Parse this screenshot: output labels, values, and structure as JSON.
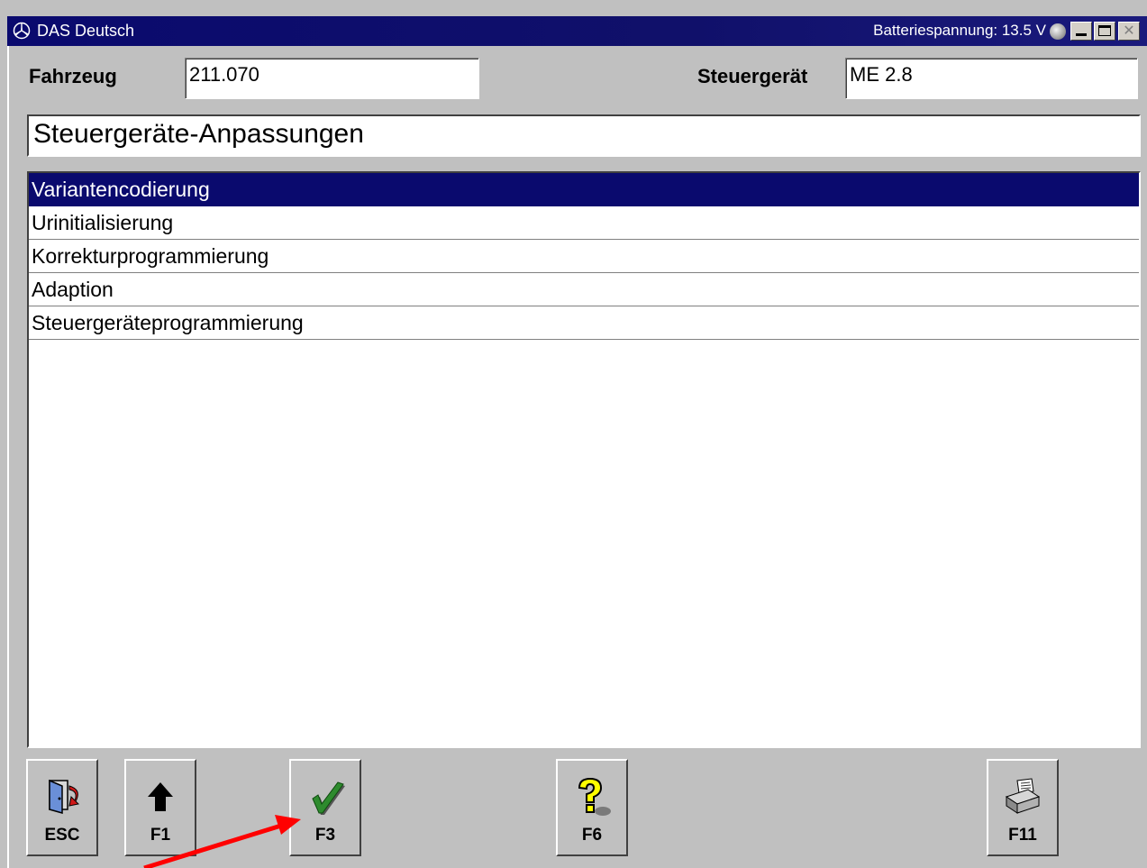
{
  "window": {
    "title": "DAS Deutsch",
    "battery_text": "Batteriespannung: 13.5 V",
    "controls": [
      "minimize-icon",
      "maximize-icon",
      "close-icon"
    ]
  },
  "header": {
    "vehicle_label": "Fahrzeug",
    "vehicle_value": "211.070",
    "ecu_label": "Steuergerät",
    "ecu_value": "ME 2.8"
  },
  "section_title": "Steuergeräte-Anpassungen",
  "menu": {
    "selected_index": 0,
    "items": [
      "Variantencodierung",
      "Urinitialisierung",
      "Korrekturprogrammierung",
      "Adaption",
      "Steuergeräteprogrammierung"
    ]
  },
  "function_keys": [
    {
      "key": "ESC",
      "icon": "exit-door-icon"
    },
    {
      "key": "F1",
      "icon": "up-arrow-icon"
    },
    {
      "key": "F3",
      "icon": "checkmark-icon"
    },
    {
      "key": "F6",
      "icon": "help-question-icon"
    },
    {
      "key": "F11",
      "icon": "printer-icon"
    }
  ],
  "colors": {
    "titlebar": "#0a0a6e",
    "selection": "#0a0a6e",
    "annotation_arrow": "#ff0000",
    "checkmark": "#2e8b2e",
    "help_yellow": "#ffff00"
  }
}
